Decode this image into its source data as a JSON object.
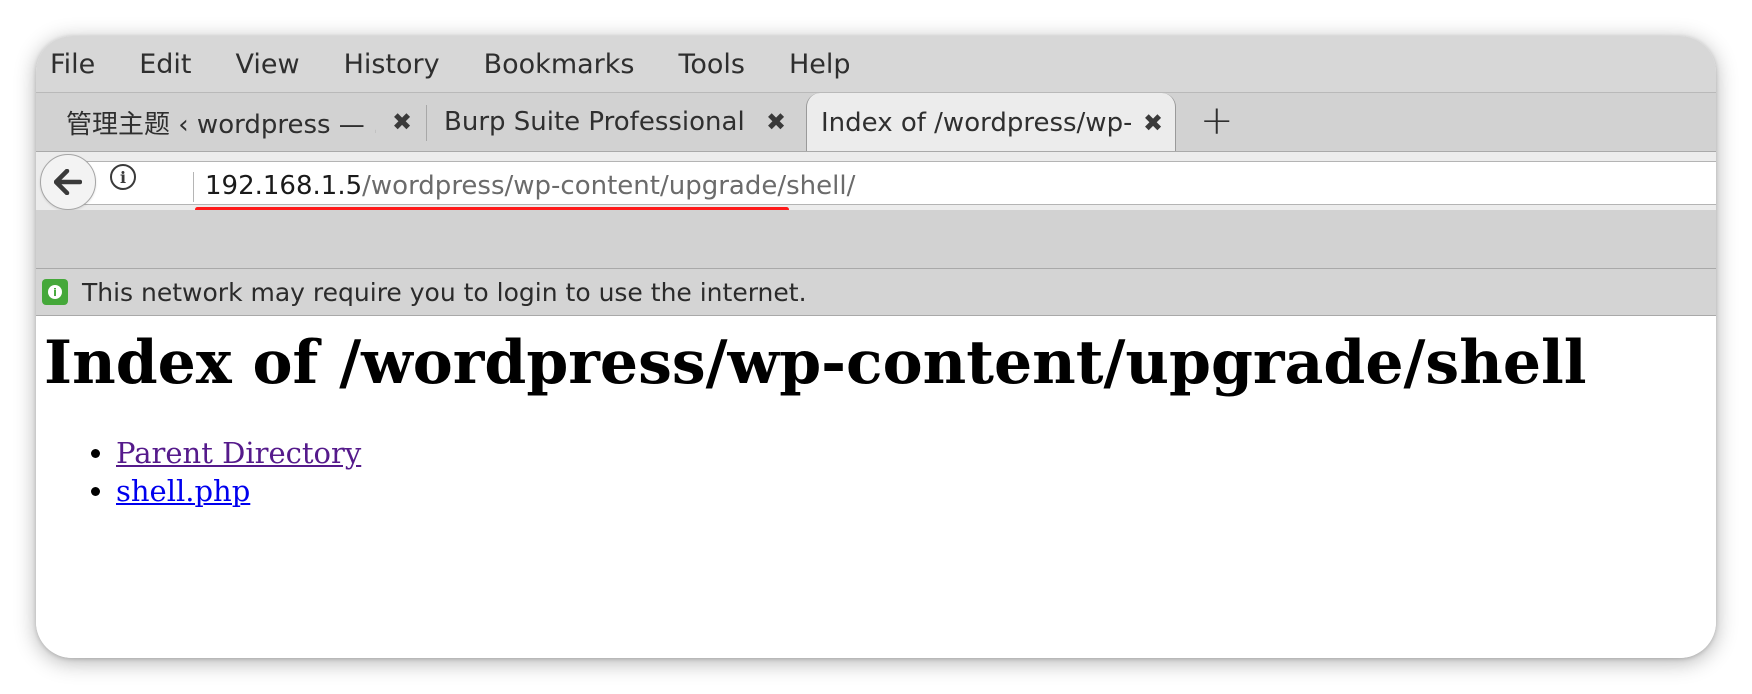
{
  "menubar": {
    "items": [
      "File",
      "Edit",
      "View",
      "History",
      "Bookmarks",
      "Tools",
      "Help"
    ]
  },
  "tabs": [
    {
      "label": "管理主题 ‹ wordpress — ...",
      "close": "✖"
    },
    {
      "label": "Burp Suite Professional",
      "close": "✖"
    },
    {
      "label": "Index of /wordpress/wp-...",
      "close": "✖"
    }
  ],
  "new_tab": "+",
  "urlbar": {
    "host": "192.168.1.5",
    "path": "/wordpress/wp-content/upgrade/shell/"
  },
  "notification": {
    "text": "This network may require you to login to use the internet."
  },
  "page": {
    "title": "Index of /wordpress/wp-content/upgrade/shell",
    "links": [
      "Parent Directory",
      "shell.php"
    ]
  },
  "colors": {
    "annotation_underline": "#ff1a1a",
    "visited_link": "#551a8b",
    "link": "#0000ee",
    "notification_icon": "#45a83a"
  }
}
